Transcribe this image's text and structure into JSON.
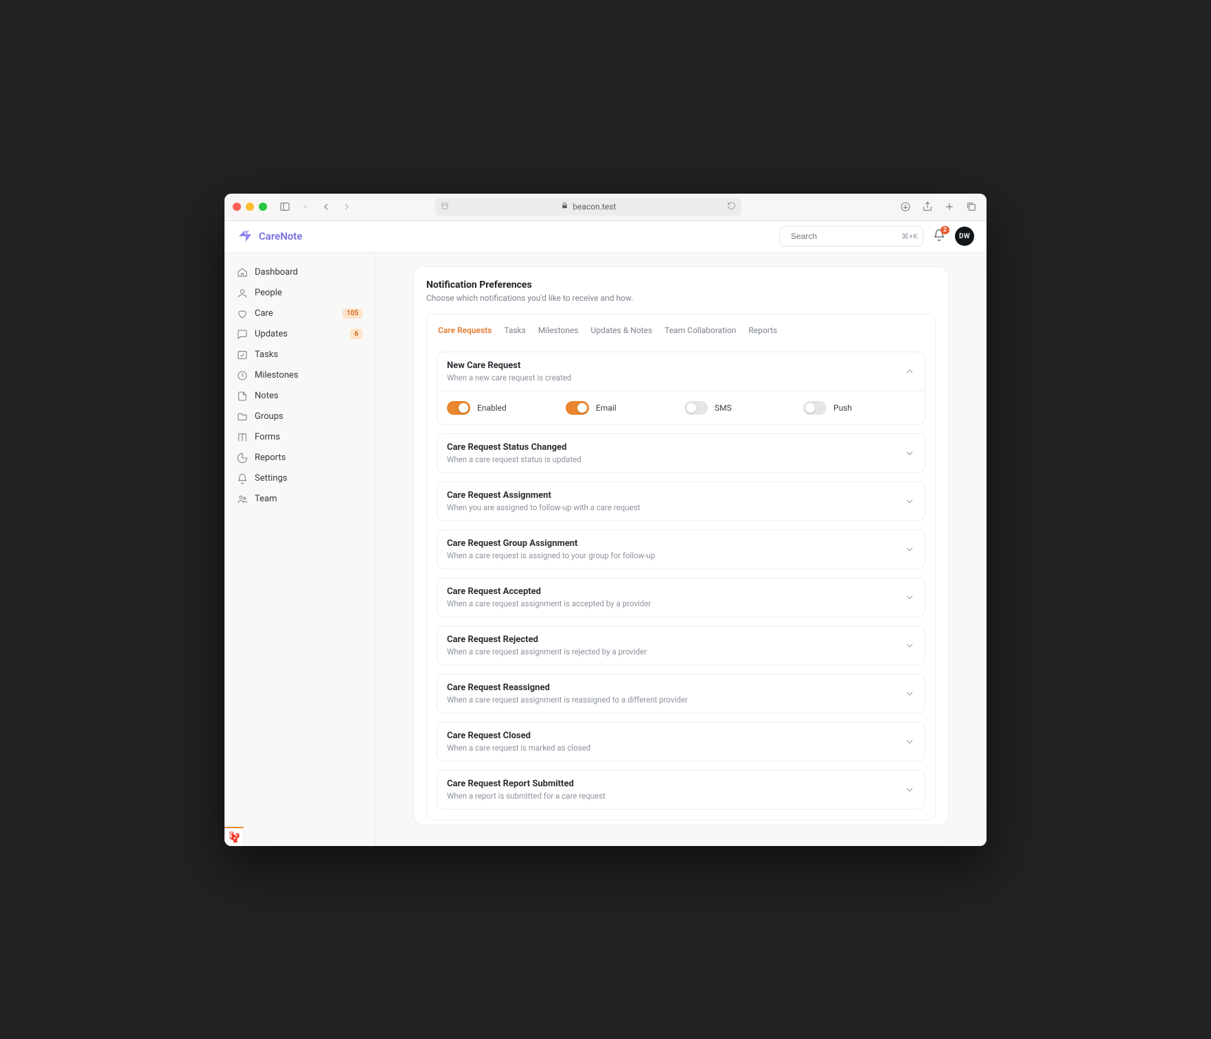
{
  "chrome": {
    "url_host": "beacon.test"
  },
  "header": {
    "brand": "CareNote",
    "search_placeholder": "Search",
    "search_kbd": "⌘+K",
    "notif_count": "2",
    "avatar_initials": "DW"
  },
  "sidebar": {
    "items": [
      {
        "label": "Dashboard",
        "icon": "home"
      },
      {
        "label": "People",
        "icon": "user"
      },
      {
        "label": "Care",
        "icon": "heart",
        "count": "105"
      },
      {
        "label": "Updates",
        "icon": "chat",
        "count": "6"
      },
      {
        "label": "Tasks",
        "icon": "check"
      },
      {
        "label": "Milestones",
        "icon": "flag"
      },
      {
        "label": "Notes",
        "icon": "doc"
      },
      {
        "label": "Groups",
        "icon": "folder"
      },
      {
        "label": "Forms",
        "icon": "book"
      },
      {
        "label": "Reports",
        "icon": "chart"
      },
      {
        "label": "Settings",
        "icon": "bell"
      },
      {
        "label": "Team",
        "icon": "team"
      }
    ]
  },
  "panel": {
    "title": "Notification Preferences",
    "subtitle": "Choose which notifications you'd like to receive and how."
  },
  "tabs": {
    "items": [
      {
        "label": "Care Requests",
        "active": true
      },
      {
        "label": "Tasks"
      },
      {
        "label": "Milestones"
      },
      {
        "label": "Updates & Notes"
      },
      {
        "label": "Team Collaboration"
      },
      {
        "label": "Reports"
      }
    ]
  },
  "toggles": {
    "enabled": "Enabled",
    "email": "Email",
    "sms": "SMS",
    "push": "Push"
  },
  "prefs": [
    {
      "title": "New Care Request",
      "desc": "When a new care request is created",
      "expanded": true,
      "state": {
        "enabled": true,
        "email": true,
        "sms": false,
        "push": false
      }
    },
    {
      "title": "Care Request Status Changed",
      "desc": "When a care request status is updated"
    },
    {
      "title": "Care Request Assignment",
      "desc": "When you are assigned to follow-up with a care request"
    },
    {
      "title": "Care Request Group Assignment",
      "desc": "When a care request is assigned to your group for follow-up"
    },
    {
      "title": "Care Request Accepted",
      "desc": "When a care request assignment is accepted by a provider"
    },
    {
      "title": "Care Request Rejected",
      "desc": "When a care request assignment is rejected by a provider"
    },
    {
      "title": "Care Request Reassigned",
      "desc": "When a care request assignment is reassigned to a different provider"
    },
    {
      "title": "Care Request Closed",
      "desc": "When a care request is marked as closed"
    },
    {
      "title": "Care Request Report Submitted",
      "desc": "When a report is submitted for a care request"
    }
  ]
}
